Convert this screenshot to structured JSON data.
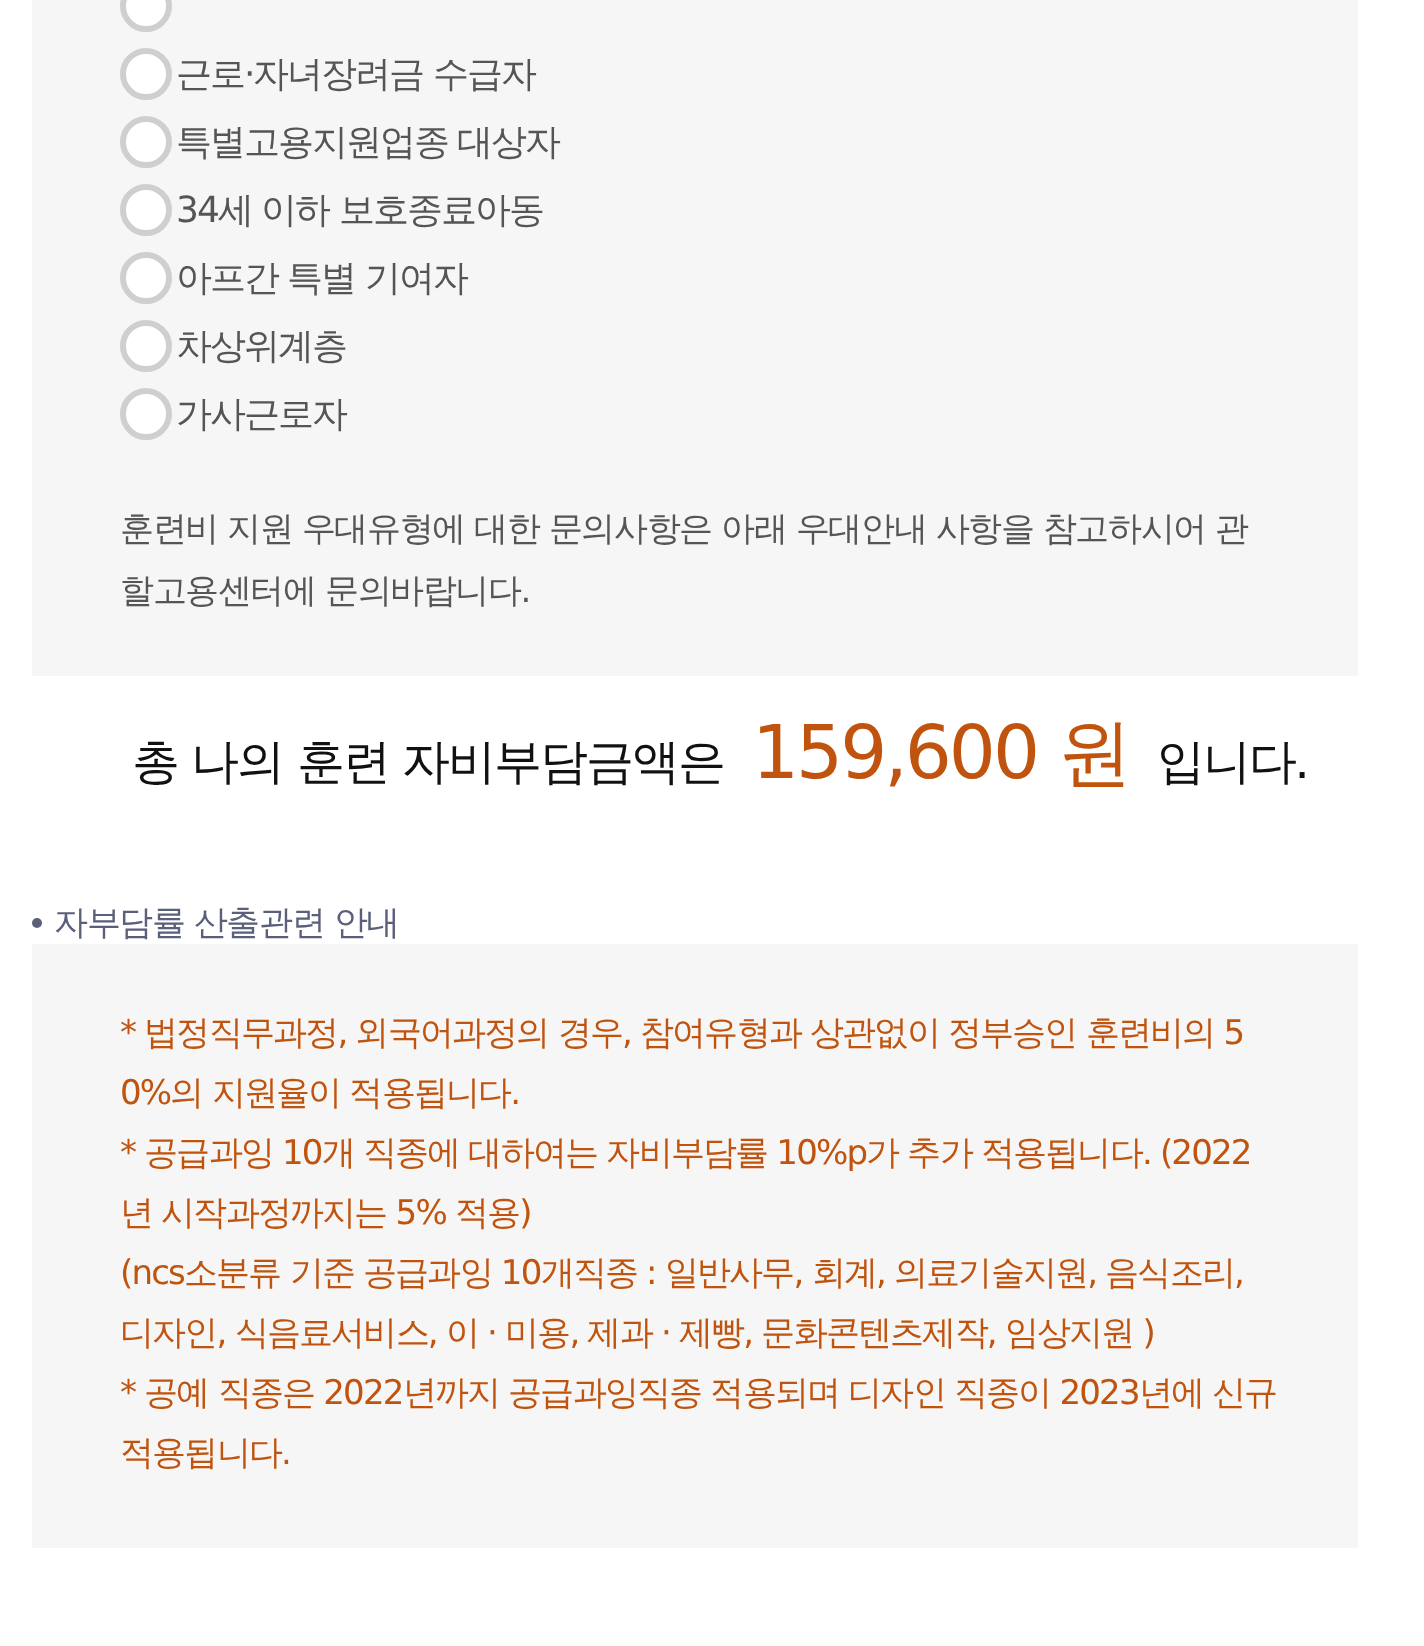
{
  "preferential_types": {
    "options": [
      {
        "selected": false
      },
      {
        "label": "근로·자녀장려금 수급자",
        "selected": false
      },
      {
        "label": "특별고용지원업종 대상자",
        "selected": false
      },
      {
        "label": "34세 이하 보호종료아동",
        "selected": false
      },
      {
        "label": "아프간 특별 기여자",
        "selected": false
      },
      {
        "label": "차상위계층",
        "selected": false
      },
      {
        "label": "가사근로자",
        "selected": false
      }
    ],
    "notice": "훈련비 지원 우대유형에 대한 문의사항은 아래 우대안내 사항을 참고하시어 관할고용센터에 문의바랍니다."
  },
  "total": {
    "prefix": "총 나의 훈련 자비부담금액은",
    "amount": "159,600 원",
    "suffix": "입니다."
  },
  "rate_info": {
    "title": "자부담률 산출관련 안내",
    "notes": [
      "* 법정직무과정, 외국어과정의 경우, 참여유형과 상관없이 정부승인 훈련비의 50%의 지원율이 적용됩니다.",
      "* 공급과잉 10개 직종에 대하여는 자비부담률 10%p가 추가 적용됩니다. (2022년 시작과정까지는 5% 적용)",
      "(ncs소분류 기준 공급과잉 10개직종 : 일반사무, 회계, 의료기술지원, 음식조리, 디자인, 식음료서비스, 이 · 미용, 제과 · 제빵, 문화콘텐츠제작, 임상지원 )",
      "* 공예 직종은 2022년까지 공급과잉직종 적용되며 디자인 직종이 2023년에 신규 적용됩니다."
    ]
  }
}
